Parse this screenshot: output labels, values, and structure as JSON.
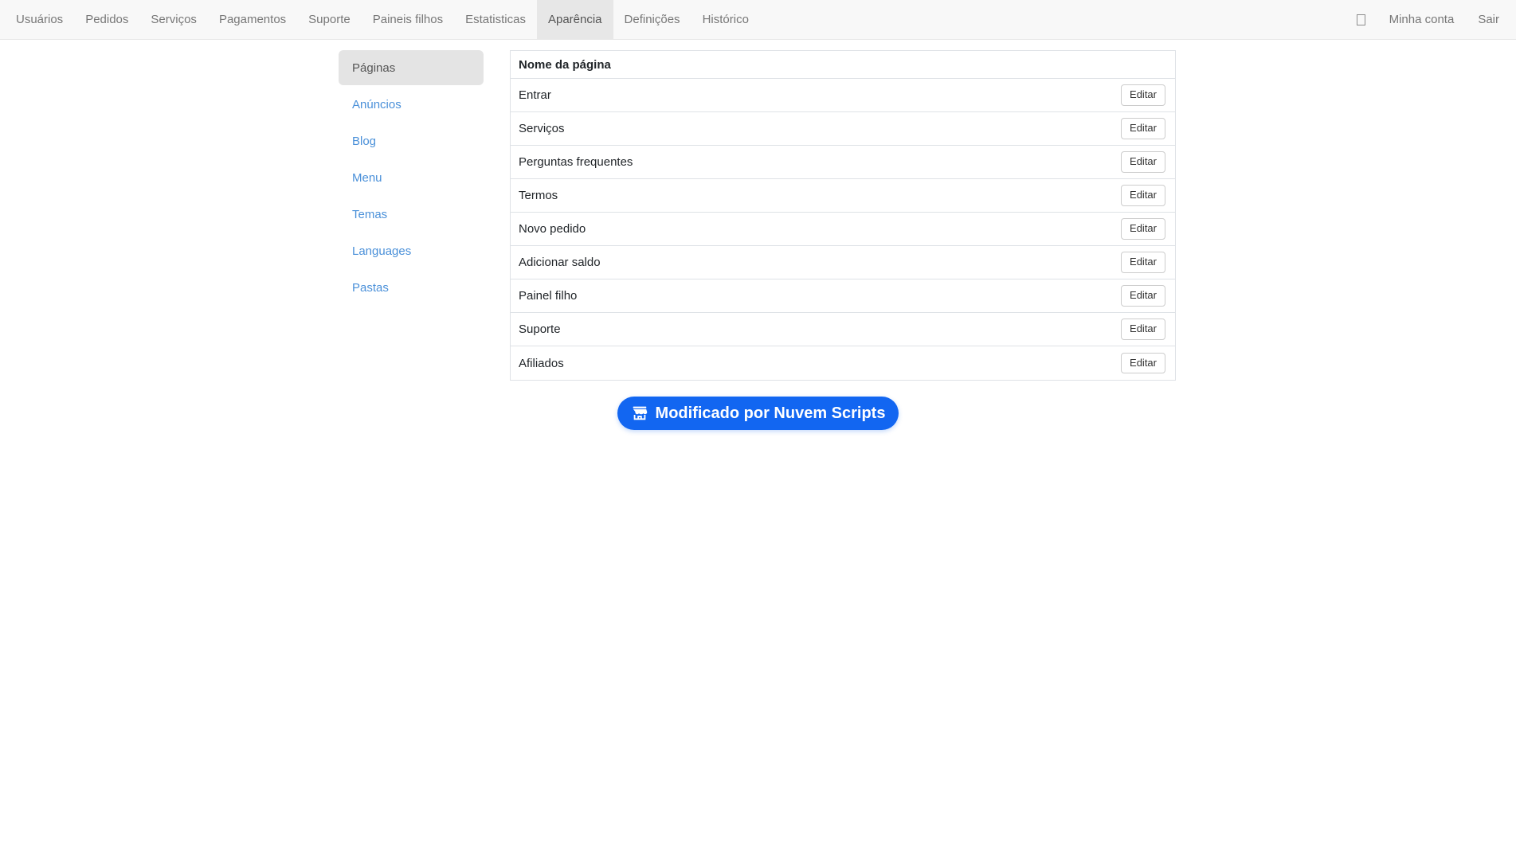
{
  "nav": {
    "items": [
      {
        "label": "Usuários",
        "active": false
      },
      {
        "label": "Pedidos",
        "active": false
      },
      {
        "label": "Serviços",
        "active": false
      },
      {
        "label": "Pagamentos",
        "active": false
      },
      {
        "label": "Suporte",
        "active": false
      },
      {
        "label": "Paineis filhos",
        "active": false
      },
      {
        "label": "Estatisticas",
        "active": false
      },
      {
        "label": "Aparência",
        "active": true
      },
      {
        "label": "Definições",
        "active": false
      },
      {
        "label": "Histórico",
        "active": false
      }
    ],
    "right": {
      "account_label": "Minha conta",
      "logout_label": "Sair"
    }
  },
  "sidebar": {
    "items": [
      {
        "label": "Páginas",
        "active": true
      },
      {
        "label": "Anúncios",
        "active": false
      },
      {
        "label": "Blog",
        "active": false
      },
      {
        "label": "Menu",
        "active": false
      },
      {
        "label": "Temas",
        "active": false
      },
      {
        "label": "Languages",
        "active": false
      },
      {
        "label": "Pastas",
        "active": false
      }
    ]
  },
  "table": {
    "header_label": "Nome da página",
    "edit_button_label": "Editar",
    "rows": [
      "Entrar",
      "Serviços",
      "Perguntas frequentes",
      "Termos",
      "Novo pedido",
      "Adicionar saldo",
      "Painel filho",
      "Suporte",
      "Afiliados"
    ]
  },
  "footer_button": {
    "label": "Modificado por Nuvem Scripts",
    "icon": "storefront-icon"
  },
  "colors": {
    "accent_blue": "#1266f1",
    "sidebar_link_blue": "#4a90d9",
    "navbar_bg": "#f8f8f8",
    "active_item_bg": "#e7e7e7",
    "table_border": "#dee2e6"
  }
}
